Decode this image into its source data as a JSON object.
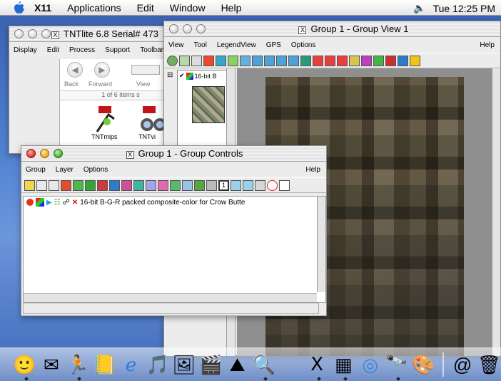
{
  "menubar": {
    "app": "X11",
    "items": [
      "Applications",
      "Edit",
      "Window",
      "Help"
    ],
    "clock": "Tue 12:25 PM"
  },
  "tntlite": {
    "title": "TNTlite 6.8  Serial# 473",
    "menu": [
      "Display",
      "Edit",
      "Process",
      "Support",
      "Toolbars"
    ],
    "finder": {
      "back": "Back",
      "forward": "Forward",
      "view": "View",
      "count": "1 of 6 items s",
      "icon1_label": "TNTmips",
      "icon2_label": "TNTvi"
    }
  },
  "groupview": {
    "title": "Group 1 - Group View 1",
    "menu": [
      "View",
      "Tool",
      "LegendView",
      "GPS",
      "Options"
    ],
    "help": "Help",
    "legend_item": "16-bit B"
  },
  "groupcontrols": {
    "title": "Group 1 - Group Controls",
    "menu": [
      "Group",
      "Layer",
      "Options"
    ],
    "help": "Help",
    "toolbar_numbers": [
      "1"
    ],
    "layer": "16-bit B-G-R packed composite-color for Crow Butte"
  },
  "dock": {
    "items": [
      "finder-icon",
      "mail-icon",
      "ichat-icon",
      "address-book-icon",
      "ie-icon",
      "itunes-icon",
      "iphoto-icon",
      "imovie-icon",
      "tnt-icon",
      "sherlock-icon",
      "system-prefs-icon",
      "x11-icon",
      "terminal-icon",
      "network-icon",
      "tntmips-icon",
      "separator",
      "internet-icon",
      "trash-icon"
    ]
  },
  "colors": {
    "desktop": "#4f7fcf",
    "close": "#e0291d",
    "minimize": "#e8a316",
    "zoom": "#3aaa2a"
  }
}
